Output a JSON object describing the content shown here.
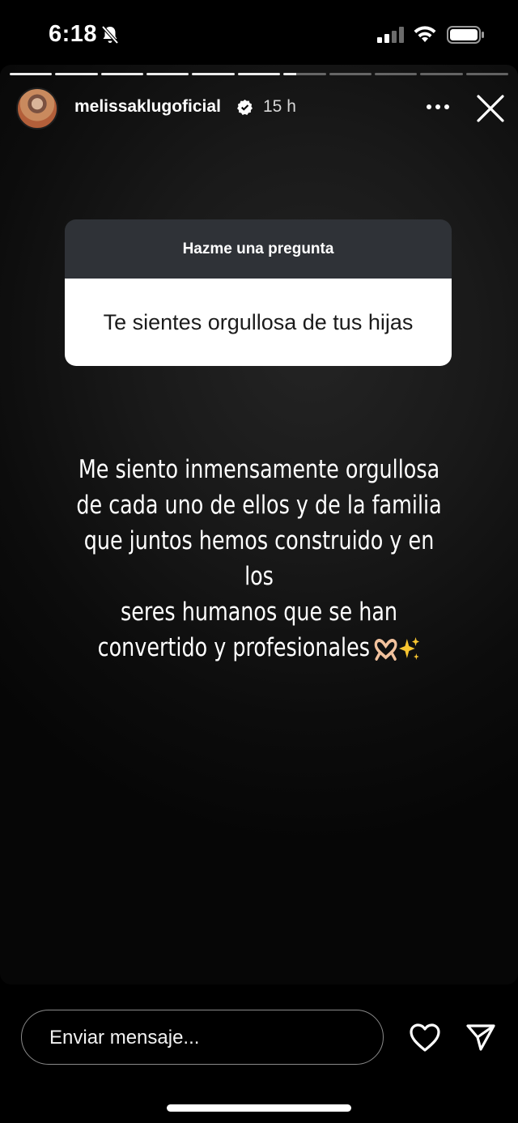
{
  "status_bar": {
    "time": "6:18"
  },
  "story": {
    "progress": {
      "total_segments": 11,
      "completed_segments": 6,
      "current_progress": 0.3
    },
    "header": {
      "username": "melissaklugoficial",
      "time_ago": "15 h"
    },
    "question_box": {
      "title": "Hazme una pregunta",
      "question": "Te sientes orgullosa de tus hijas"
    },
    "answer": {
      "lines": [
        "Me siento inmensamente orgullosa",
        "de cada uno de ellos y de la familia",
        "que juntos hemos construido y en los",
        "seres humanos que se han",
        "convertido y profesionales"
      ]
    }
  },
  "footer": {
    "message_placeholder": "Enviar mensaje..."
  },
  "colors": {
    "question_header": "#2f3237",
    "background": "#000000",
    "text": "#ffffff"
  }
}
